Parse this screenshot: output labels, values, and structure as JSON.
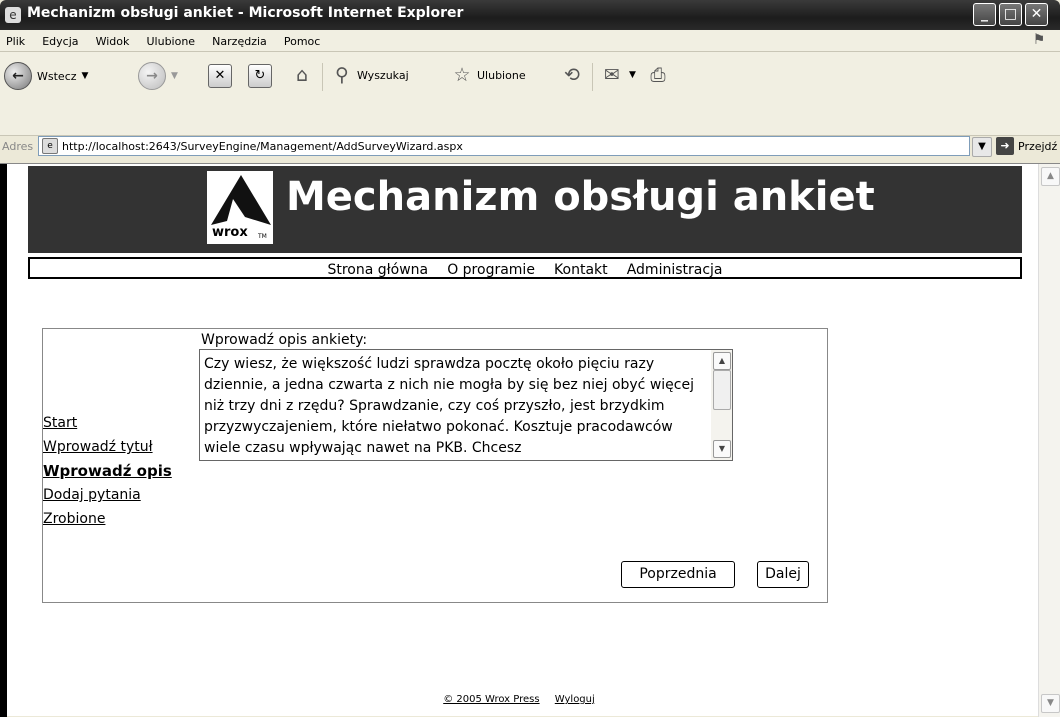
{
  "window": {
    "title": "Mechanizm obsługi ankiet - Microsoft Internet Explorer",
    "icon": "ie-icon",
    "controls": [
      "minimize",
      "maximize",
      "close"
    ]
  },
  "menu": {
    "items": [
      "Plik",
      "Edycja",
      "Widok",
      "Ulubione",
      "Narzędzia",
      "Pomoc"
    ]
  },
  "toolbar": {
    "back_label": "Wstecz",
    "search_label": "Wyszukaj",
    "favorites_label": "Ulubione"
  },
  "address": {
    "label": "Adres",
    "url": "http://localhost:2643/SurveyEngine/Management/AddSurveyWizard.aspx",
    "go_label": "Przejdź"
  },
  "page": {
    "logo_text": "wrox",
    "logo_tm": "TM",
    "site_title": "Mechanizm obsługi ankiet",
    "nav": [
      "Strona główna",
      "O programie",
      "Kontakt",
      "Administracja"
    ],
    "wizard": {
      "steps": [
        "Start",
        "Wprowadź tytuł",
        "Wprowadź opis",
        "Dodaj pytania",
        "Zrobione"
      ],
      "active_step": "Wprowadź opis",
      "field_label": "Wprowadź opis ankiety:",
      "description": "Czy wiesz, że większość ludzi sprawdza pocztę około pięciu razy dziennie, a jedna czwarta z nich nie mogła by się bez niej obyć więcej niż trzy dni z rzędu? Sprawdzanie, czy coś przyszło, jest brzydkim przyzwyczajeniem, które niełatwo pokonać. Kosztuje pracodawców wiele czasu wpływając nawet na PKB. Chcesz",
      "prev_button": "Poprzednia",
      "next_button": "Dalej"
    },
    "footer": {
      "copyright": "© 2005 Wrox Press",
      "logout": "Wyloguj"
    }
  }
}
